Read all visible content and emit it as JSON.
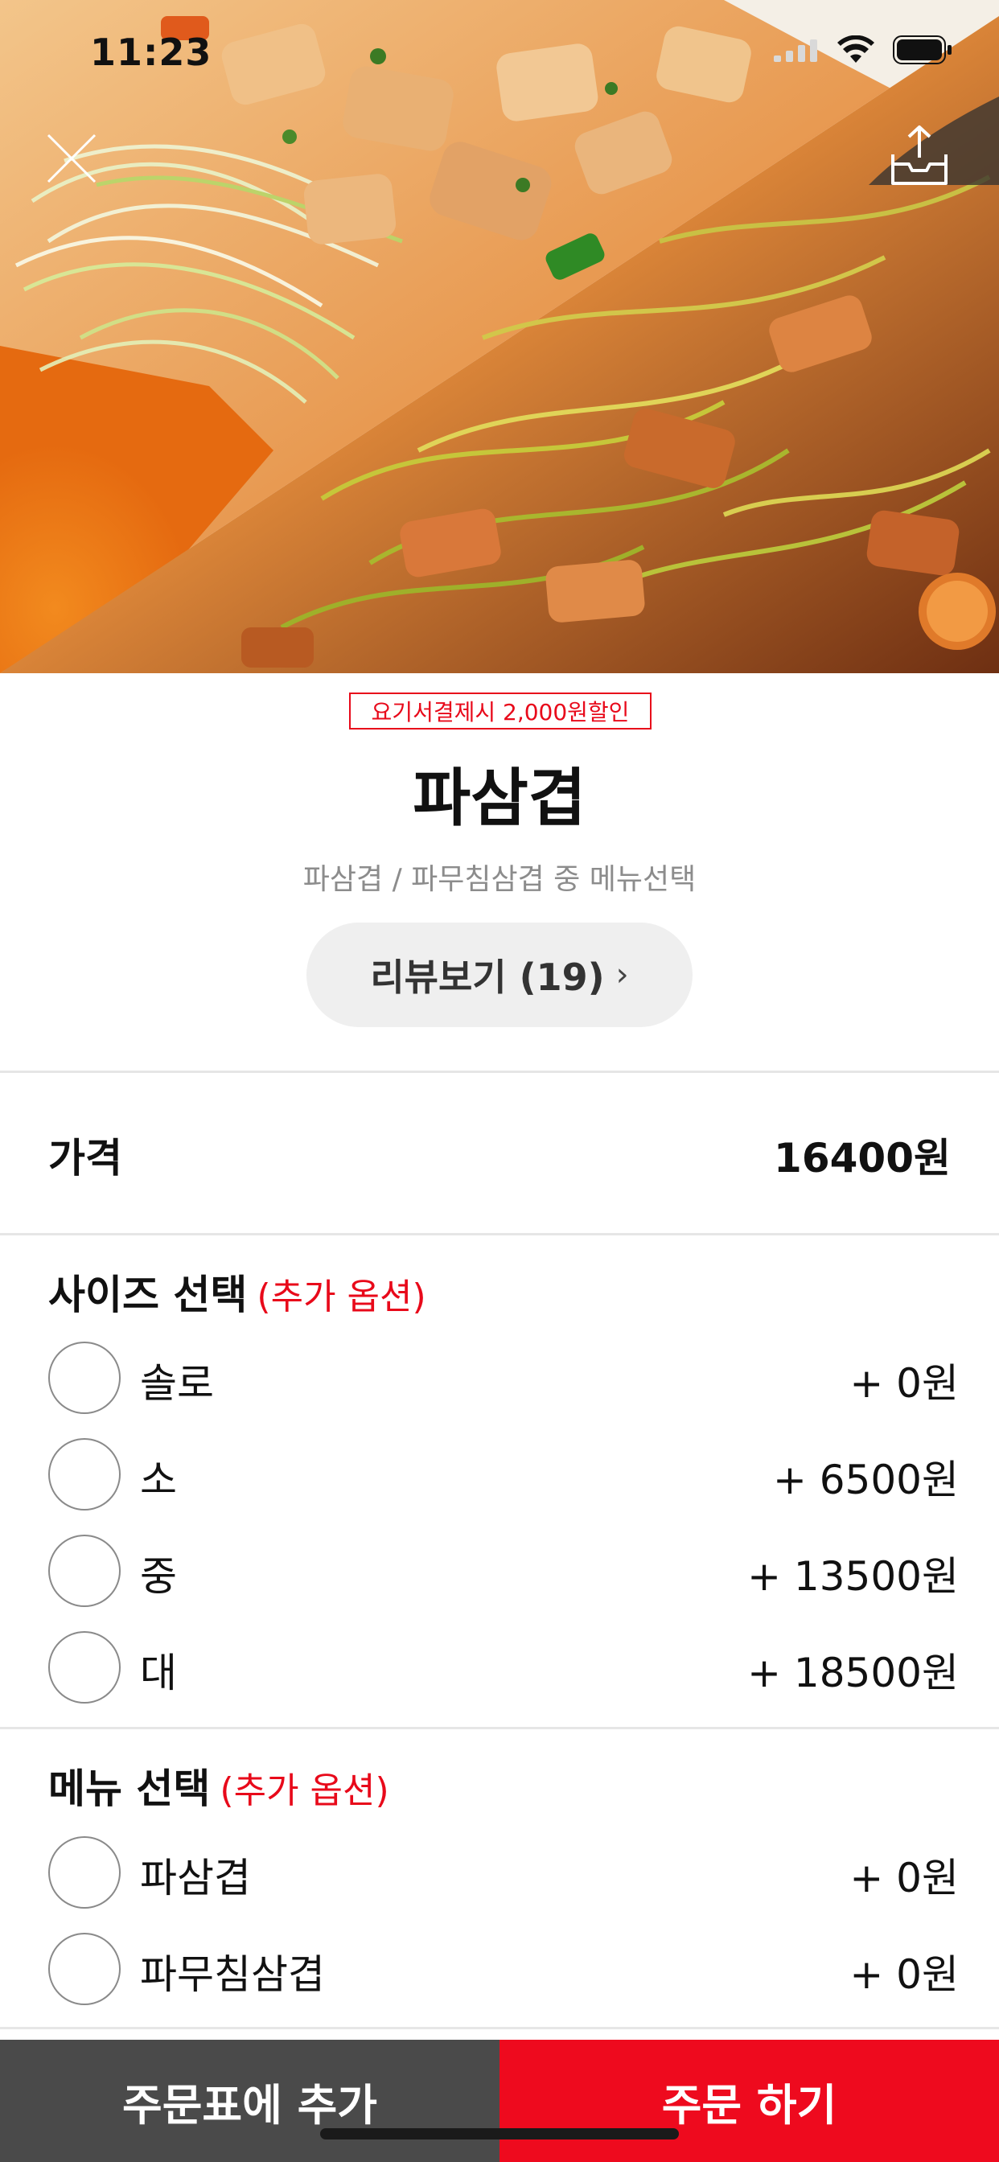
{
  "status_bar": {
    "time": "11:23"
  },
  "header": {
    "discount_badge": "요기서결제시 2,000원할인",
    "title": "파삼겹",
    "description": "파삼겹 / 파무침삼겹 중 메뉴선택",
    "review_button": "리뷰보기 (19)",
    "review_chevron": "›"
  },
  "price": {
    "label": "가격",
    "value": "16400원"
  },
  "size_group": {
    "title": "사이즈 선택",
    "extra": "(추가 옵션)",
    "options": [
      {
        "label": "솔로",
        "price": "+ 0원"
      },
      {
        "label": "소",
        "price": "+ 6500원"
      },
      {
        "label": "중",
        "price": "+ 13500원"
      },
      {
        "label": "대",
        "price": "+ 18500원"
      }
    ]
  },
  "menu_group": {
    "title": "메뉴 선택",
    "extra": "(추가 옵션)",
    "options": [
      {
        "label": "파삼겹",
        "price": "+ 0원"
      },
      {
        "label": "파무침삼겹",
        "price": "+ 0원"
      }
    ]
  },
  "bottom_bar": {
    "add_to_cart": "주문표에 추가",
    "order_now": "주문 하기"
  },
  "icons": {
    "close": "close-icon",
    "share": "share-icon",
    "wifi": "wifi-icon",
    "battery": "battery-icon",
    "signal": "signal-icon"
  },
  "colors": {
    "accent": "#e8091a",
    "cart_button": "#4a4a4a",
    "order_button": "#ee0a1e"
  }
}
